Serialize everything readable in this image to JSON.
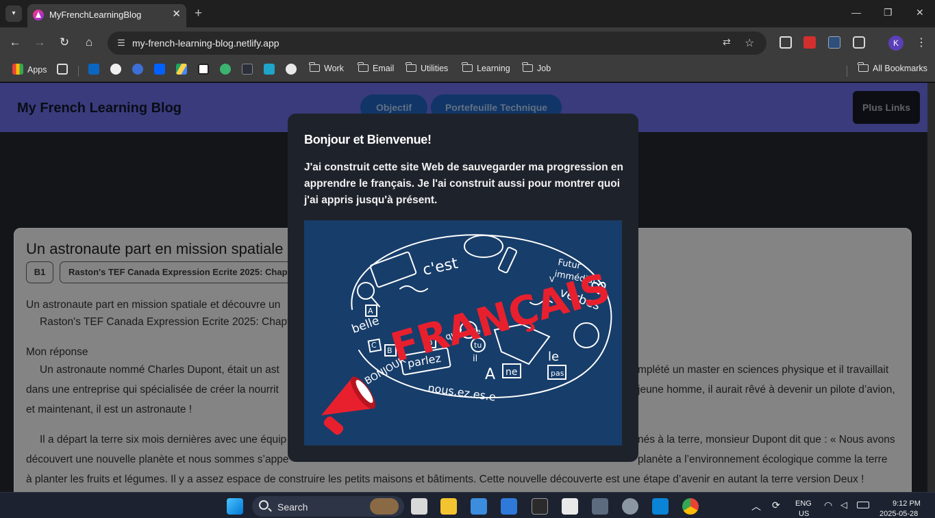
{
  "browser": {
    "tab_title": "MyFrenchLearningBlog",
    "url": "my-french-learning-blog.netlify.app",
    "profile_initial": "K",
    "bookmarks": {
      "apps": "Apps",
      "work": "Work",
      "email": "Email",
      "utilities": "Utilities",
      "learning": "Learning",
      "job": "Job",
      "all": "All Bookmarks"
    }
  },
  "site": {
    "title": "My French Learning Blog",
    "nav": [
      "Objectif",
      "Portefeuille Technique"
    ],
    "plus_links": "Plus Links"
  },
  "post": {
    "title": "Un astronaute part en mission spatiale",
    "tags": [
      "B1",
      "Raston's TEF Canada Expression Ecrite 2025: Chap"
    ],
    "intro_line1": "Un astronaute part en mission spatiale et découvre un",
    "intro_line2": "Raston's TEF Canada Expression Ecrite 2025: Chapt",
    "response_heading": "Mon réponse",
    "p1_left_1": "Un astronaute nommé Charles Dupont, était un ast",
    "p1_right_1": "mplété un master en sciences physique et il travaillait",
    "p1_left_2": "dans une entreprise qui spécialisée de créer la nourrit",
    "p1_right_2": "jeune homme, il aurait rêvé à devenir un pilote d’avion,",
    "p1_line3": "et maintenant, il est un astronaute !",
    "p2_left_1": "Il a départ la terre six mois dernières avec une équip",
    "p2_right_1": "nés à la terre, monsieur Dupont dit que : « Nous avons",
    "p2_left_2": "découvert une nouvelle planète et nous sommes s’appe",
    "p2_right_2": "planète a l’environnement écologique comme la terre",
    "p2_line3": "à planter les fruits et légumes. Il y a assez espace de construire les petits maisons et bâtiments. Cette nouvelle découverte est une étape d’avenir en autant la terre version Deux !"
  },
  "modal": {
    "title": "Bonjour et Bienvenue!",
    "body": "J'ai construit cette site Web de sauvegarder ma progression en apprendre le français. Je l'ai construit aussi pour montrer quoi j'ai appris jusqu'à présent.",
    "image": {
      "headline": "FRANÇAIS",
      "doodles": [
        "c'est",
        "Futur immédiat",
        "verbes",
        "belle",
        "parlez",
        "BONJOUR",
        "qui?",
        "je",
        "tu",
        "il",
        "le",
        "pas",
        "nous",
        "ez",
        "es",
        "e",
        "ne",
        "A",
        "B",
        "C",
        "D",
        "V"
      ]
    }
  },
  "taskbar": {
    "search_label": "Search",
    "lang": "ENG",
    "region": "US",
    "time": "9:12 PM",
    "date": "2025-05-28"
  },
  "colors": {
    "site_header": "#5c5fc8",
    "nav_pill": "#1c56a6",
    "modal_bg": "#1e232b",
    "image_bg": "#173d6a",
    "headline_red": "#e8202e"
  }
}
